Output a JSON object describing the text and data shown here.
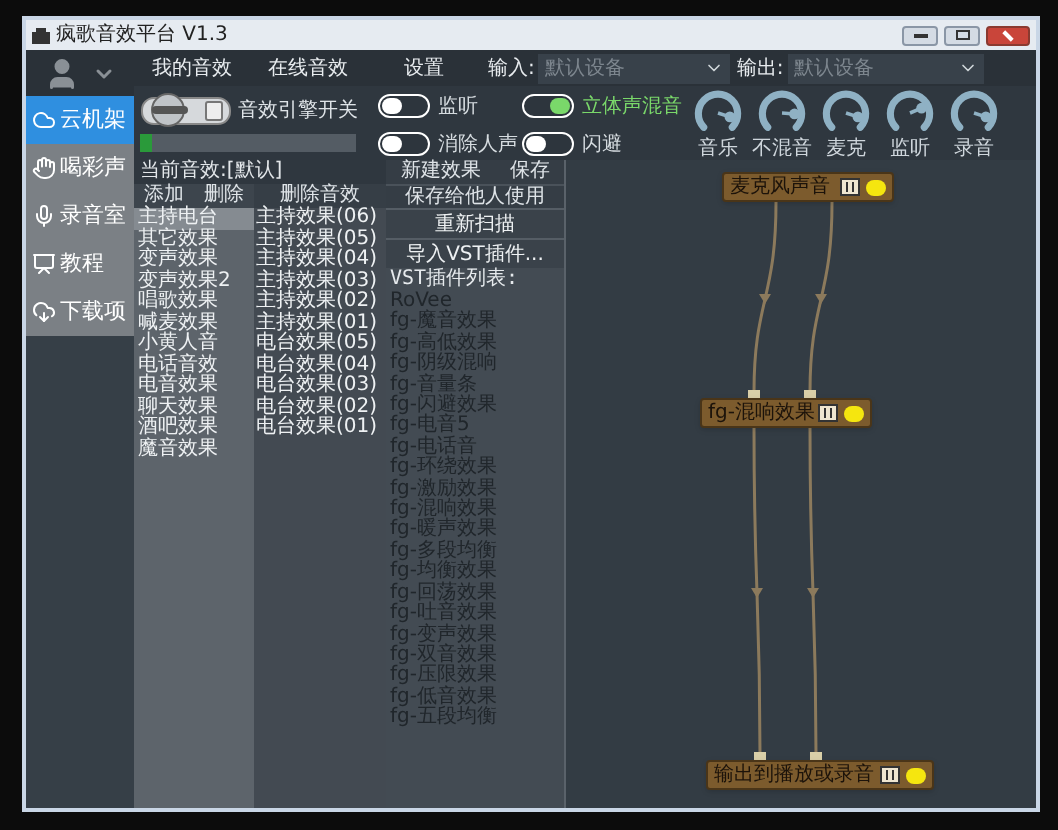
{
  "window": {
    "title": "疯歌音效平台 V1.3"
  },
  "sidebar": {
    "items": [
      {
        "label": "云机架",
        "selected": true
      },
      {
        "label": "喝彩声",
        "selected": false
      },
      {
        "label": "录音室",
        "selected": false
      },
      {
        "label": "教程",
        "selected": false
      },
      {
        "label": "下载项",
        "selected": false
      }
    ]
  },
  "tabs": [
    {
      "label": "我的音效"
    },
    {
      "label": "在线音效"
    },
    {
      "label": "设置"
    }
  ],
  "input": {
    "label": "输入:",
    "placeholder": "默认设备"
  },
  "output": {
    "label": "输出:",
    "placeholder": "默认设备"
  },
  "engine": {
    "label": "音效引擎开关",
    "on": false,
    "level": 0.06
  },
  "toggles": [
    {
      "label": "监听",
      "on": false
    },
    {
      "label": "立体声混音",
      "on": true
    },
    {
      "label": "消除人声",
      "on": false
    },
    {
      "label": "闪避",
      "on": false
    }
  ],
  "knobs": [
    {
      "label": "音乐",
      "level": 0.9
    },
    {
      "label": "不混音",
      "level": 0.85
    },
    {
      "label": "麦克",
      "level": 0.9
    },
    {
      "label": "监听",
      "level": 0.75
    },
    {
      "label": "录音",
      "level": 0.9
    }
  ],
  "current_effect": "当前音效:[默认]",
  "effect_header": [
    "添加",
    "删除"
  ],
  "preset_header": "删除音效",
  "effects": [
    {
      "label": "主持电台",
      "selected": true
    },
    {
      "label": "其它效果",
      "selected": false
    },
    {
      "label": "变声效果",
      "selected": false
    },
    {
      "label": "变声效果2",
      "selected": false
    },
    {
      "label": "唱歌效果",
      "selected": false
    },
    {
      "label": "喊麦效果",
      "selected": false
    },
    {
      "label": "小黄人音",
      "selected": false
    },
    {
      "label": "电话音效",
      "selected": false
    },
    {
      "label": "电音效果",
      "selected": false
    },
    {
      "label": "聊天效果",
      "selected": false
    },
    {
      "label": "酒吧效果",
      "selected": false
    },
    {
      "label": "魔音效果",
      "selected": false
    }
  ],
  "presets": [
    "主持效果(06)",
    "主持效果(05)",
    "主持效果(04)",
    "主持效果(03)",
    "主持效果(02)",
    "主持效果(01)",
    "电台效果(05)",
    "电台效果(04)",
    "电台效果(03)",
    "电台效果(02)",
    "电台效果(01)"
  ],
  "vst_actions": [
    "新建效果",
    "保存"
  ],
  "share_action": "保存给他人使用",
  "buttons": [
    "重新扫描",
    "导入VST插件..."
  ],
  "vst_list_title": "VST插件列表:",
  "vst_plugins": [
    "RoVee",
    "fg-魔音效果",
    "fg-高低效果",
    "fg-阴级混响",
    "fg-音量条",
    "fg-闪避效果",
    "fg-电音5",
    "fg-电话音",
    "fg-环绕效果",
    "fg-激励效果",
    "fg-混响效果",
    "fg-暖声效果",
    "fg-多段均衡",
    "fg-均衡效果",
    "fg-回荡效果",
    "fg-吐音效果",
    "fg-变声效果",
    "fg-双音效果",
    "fg-压限效果",
    "fg-低音效果",
    "fg-五段均衡"
  ],
  "nodes": [
    {
      "label": "麦克风声音",
      "on": true
    },
    {
      "label": "fg-混响效果",
      "on": true
    },
    {
      "label": "输出到播放或录音",
      "on": true
    }
  ]
}
